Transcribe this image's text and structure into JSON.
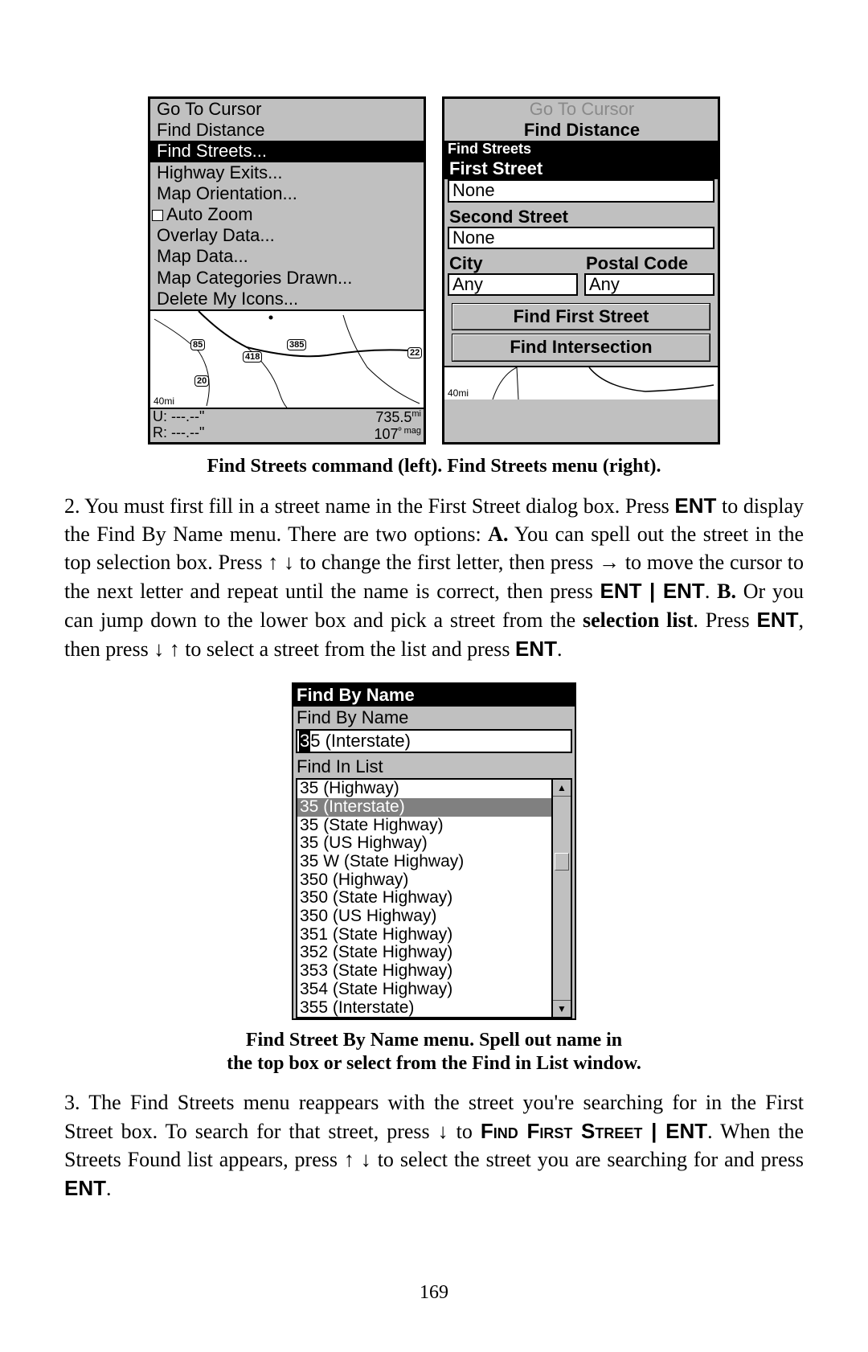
{
  "left_menu": {
    "items": [
      {
        "label": "Go To Cursor",
        "selected": false,
        "dim": false
      },
      {
        "label": "Find Distance",
        "selected": false,
        "dim": false
      },
      {
        "label": "Find Streets...",
        "selected": true,
        "dim": false
      },
      {
        "label": "Highway Exits...",
        "selected": false,
        "dim": false
      },
      {
        "label": "Map Orientation...",
        "selected": false,
        "dim": false
      },
      {
        "label": "Auto Zoom",
        "selected": false,
        "dim": false,
        "checkbox": true
      },
      {
        "label": "Overlay Data...",
        "selected": false,
        "dim": false
      },
      {
        "label": "Map Data...",
        "selected": false,
        "dim": false
      },
      {
        "label": "Map Categories Drawn...",
        "selected": false,
        "dim": false
      },
      {
        "label": "Delete My Icons...",
        "selected": false,
        "dim": false
      }
    ],
    "map_scale": "40mi",
    "status_U": "U:  ---.--\"",
    "status_R": "R:  ---.--\"",
    "status_dist": "735.5",
    "status_dist_unit": "mi",
    "status_brg": "107",
    "status_brg_unit": "º mag",
    "shields": [
      "85",
      "385",
      "418",
      "20",
      "22"
    ]
  },
  "right_panel": {
    "top_dim1": "Go To Cursor",
    "top_dim2": "Find Distance",
    "title": "Find Streets",
    "first_label": "First Street",
    "first_value": "None",
    "second_label": "Second Street",
    "second_value": "None",
    "city_label": "City",
    "city_value": "Any",
    "postal_label": "Postal Code",
    "postal_value": "Any",
    "btn1": "Find First Street",
    "btn2": "Find Intersection",
    "map_scale": "40mi"
  },
  "caption1": "Find Streets command (left). Find Streets menu (right).",
  "para1_a": "2. You must first fill in a street name in the First Street dialog box. Press ",
  "para1_ent": "ENT",
  "para1_b": " to display the Find By Name menu. There are two options: ",
  "para1_boldA": "A.",
  "para1_c": " You can spell out the street in the top selection box. Press ↑ ↓ to change the first letter, then press → to move the cursor to the next letter and repeat until the name is correct, then press ",
  "para1_entent": "ENT | ENT",
  "para1_d": ". ",
  "para1_boldB": "B.",
  "para1_e": " Or you can jump down to the lower box and pick a street from the ",
  "para1_sel": "selection list",
  "para1_f": ". Press ",
  "para1_g": ", then press ↓ ↑ to select a street from the list and press ",
  "findbyname": {
    "hdr": "Find By Name",
    "sub": "Find By Name",
    "entry_cursor": "3",
    "entry_rest": "5 (Interstate)",
    "list_label": "Find In List",
    "items": [
      "35 (Highway)",
      "35 (Interstate)",
      "35 (State Highway)",
      "35 (US Highway)",
      "35 W (State Highway)",
      "350 (Highway)",
      "350 (State Highway)",
      "350 (US Highway)",
      "351 (State Highway)",
      "352 (State Highway)",
      "353 (State Highway)",
      "354 (State Highway)",
      "355 (Interstate)"
    ],
    "selected_index": 1
  },
  "caption2a": "Find Street By Name menu. Spell out name in",
  "caption2b": "the top box or select from the Find in List window.",
  "para2_a": "3. The Find Streets menu reappears with the street you're searching for in the First Street box. To search for that street, press ↓ to ",
  "para2_sc": "Find First Street",
  "para2_b": " | ",
  "para2_c": ". When the Streets Found list appears, press ↑ ↓ to select the street you are searching for and press ",
  "page_number": "169"
}
